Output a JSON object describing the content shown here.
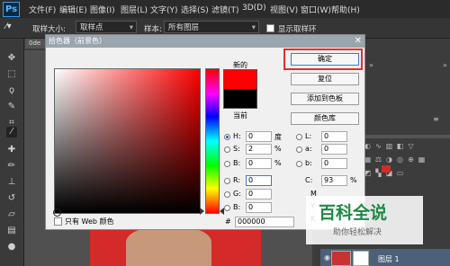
{
  "app": {
    "logo": "Ps"
  },
  "menubar": {
    "items": [
      "文件(F)",
      "编辑(E)",
      "图像(I)",
      "图层(L)",
      "文字(Y)",
      "选择(S)",
      "滤镜(T)",
      "3D(D)",
      "视图(V)",
      "窗口(W)",
      "帮助(H)"
    ]
  },
  "options_bar": {
    "sample_size_label": "取样大小:",
    "sample_size_value": "取样点",
    "sample_label": "样本:",
    "sample_value": "所有图层",
    "show_ring_label": "显示取样环"
  },
  "document": {
    "tab_label": "0de"
  },
  "color_picker": {
    "title": "拾色器（前景色）",
    "new_label": "新的",
    "current_label": "当前",
    "new_color": "#ff0000",
    "current_color": "#000000",
    "buttons": {
      "ok": "确定",
      "reset": "复位",
      "add_to_swatches": "添加到色板",
      "color_libraries": "颜色库"
    },
    "hsb": [
      {
        "label": "H:",
        "value": "0",
        "unit": "度"
      },
      {
        "label": "S:",
        "value": "2",
        "unit": "%"
      },
      {
        "label": "B:",
        "value": "0",
        "unit": "%"
      }
    ],
    "rgb": [
      {
        "label": "R:",
        "value": "0"
      },
      {
        "label": "G:",
        "value": "0"
      },
      {
        "label": "B:",
        "value": "0"
      }
    ],
    "lab": [
      {
        "label": "L:",
        "value": "0"
      },
      {
        "label": "a:",
        "value": "0"
      },
      {
        "label": "b:",
        "value": "0"
      }
    ],
    "cmyk_c": {
      "label": "C:",
      "value": "93",
      "unit": "%"
    },
    "cmyk_letters": [
      "M",
      "Y",
      "K"
    ],
    "hex_label": "#",
    "hex_value": "000000",
    "web_only_label": "只有 Web 颜色"
  },
  "watermark": {
    "title": "百科全说",
    "subtitle": "助你轻松解决"
  },
  "layers": {
    "layer_name": "图层 1"
  }
}
